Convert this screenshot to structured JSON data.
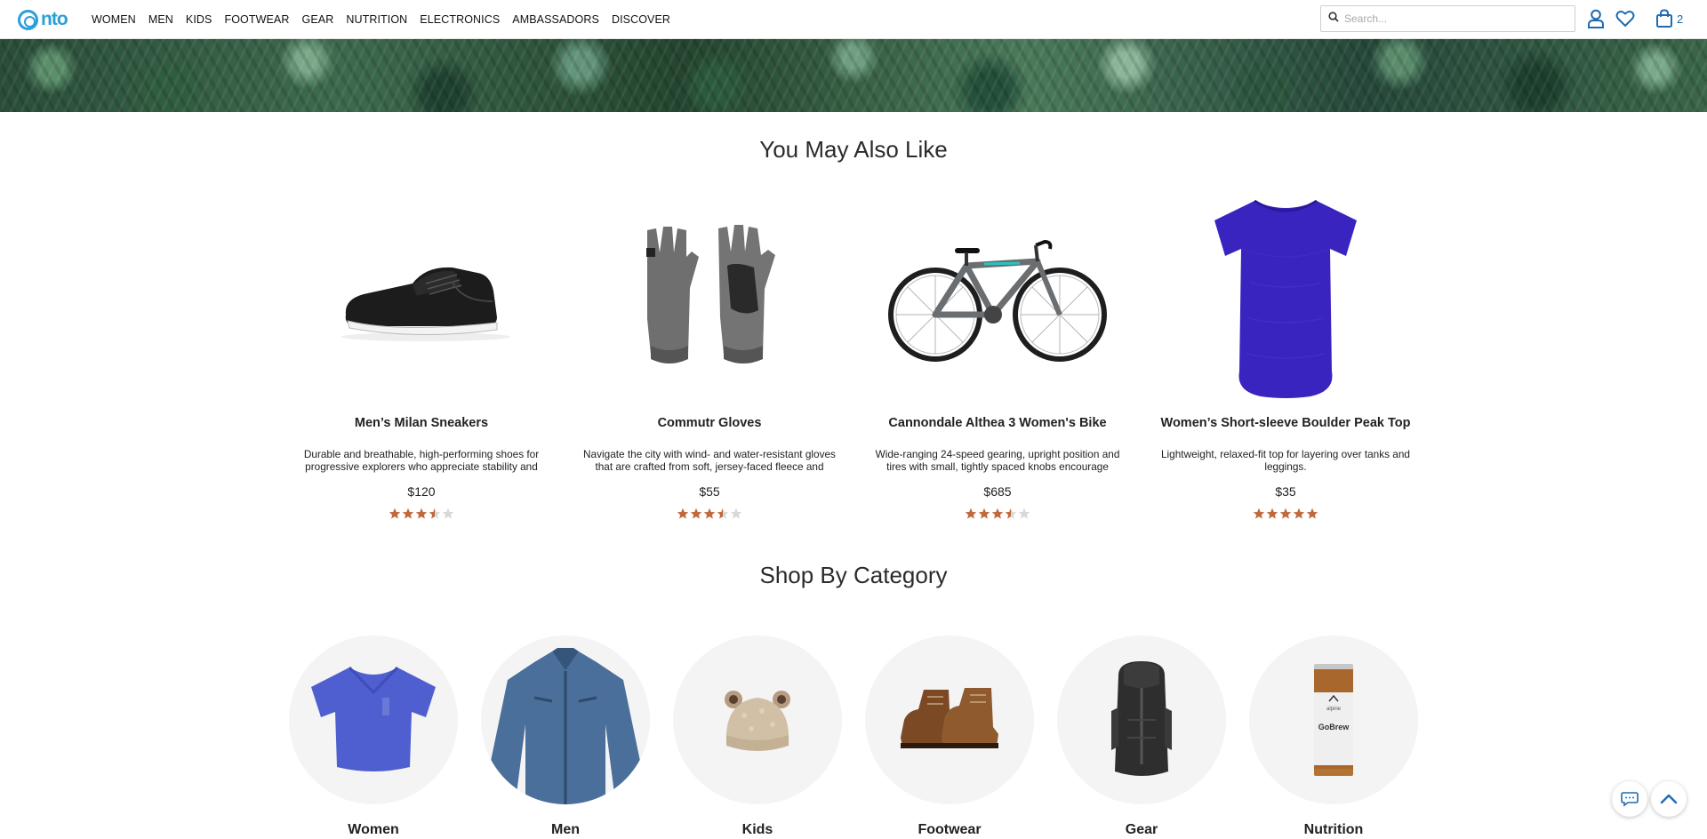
{
  "header": {
    "logo_text": "nto",
    "nav": [
      "WOMEN",
      "MEN",
      "KIDS",
      "FOOTWEAR",
      "GEAR",
      "NUTRITION",
      "ELECTRONICS",
      "AMBASSADORS",
      "DISCOVER"
    ],
    "search_placeholder": "Search...",
    "cart_count": "2",
    "brand_color": "#2a9fd8",
    "icon_color": "#1f6bb0"
  },
  "recommendations": {
    "title": "You May Also Like",
    "products": [
      {
        "name": "Men’s Milan Sneakers",
        "description": "Durable and breathable, high-performing shoes for progressive explorers who appreciate stability and",
        "price": "$120",
        "rating": 3.5,
        "image_icon": "sneaker-image"
      },
      {
        "name": "Commutr Gloves",
        "description": "Navigate the city with wind- and water-resistant gloves that are crafted from soft, jersey-faced fleece and feature",
        "price": "$55",
        "rating": 3.5,
        "image_icon": "gloves-image"
      },
      {
        "name": "Cannondale Althea 3 Women's Bike",
        "description": "Wide-ranging 24-speed gearing, upright position and tires with small, tightly spaced knobs encourage exploration",
        "price": "$685",
        "rating": 3.5,
        "image_icon": "bike-image"
      },
      {
        "name": "Women’s Short-sleeve Boulder Peak Top",
        "description": "Lightweight, relaxed-fit top for layering over tanks and leggings.",
        "price": "$35",
        "rating": 5,
        "image_icon": "tshirt-image"
      }
    ],
    "star_color": "#c0693c",
    "star_empty_color": "#d8d8d8"
  },
  "categories": {
    "title": "Shop By Category",
    "items": [
      {
        "label": "Women",
        "image_icon": "womens-shirt-image"
      },
      {
        "label": "Men",
        "image_icon": "mens-jacket-image"
      },
      {
        "label": "Kids",
        "image_icon": "kids-hat-image"
      },
      {
        "label": "Footwear",
        "image_icon": "boots-image"
      },
      {
        "label": "Gear",
        "image_icon": "backpack-image"
      },
      {
        "label": "Nutrition",
        "image_icon": "drink-can-image",
        "can_brand": "alpine",
        "can_label": "GoBrew"
      }
    ]
  }
}
